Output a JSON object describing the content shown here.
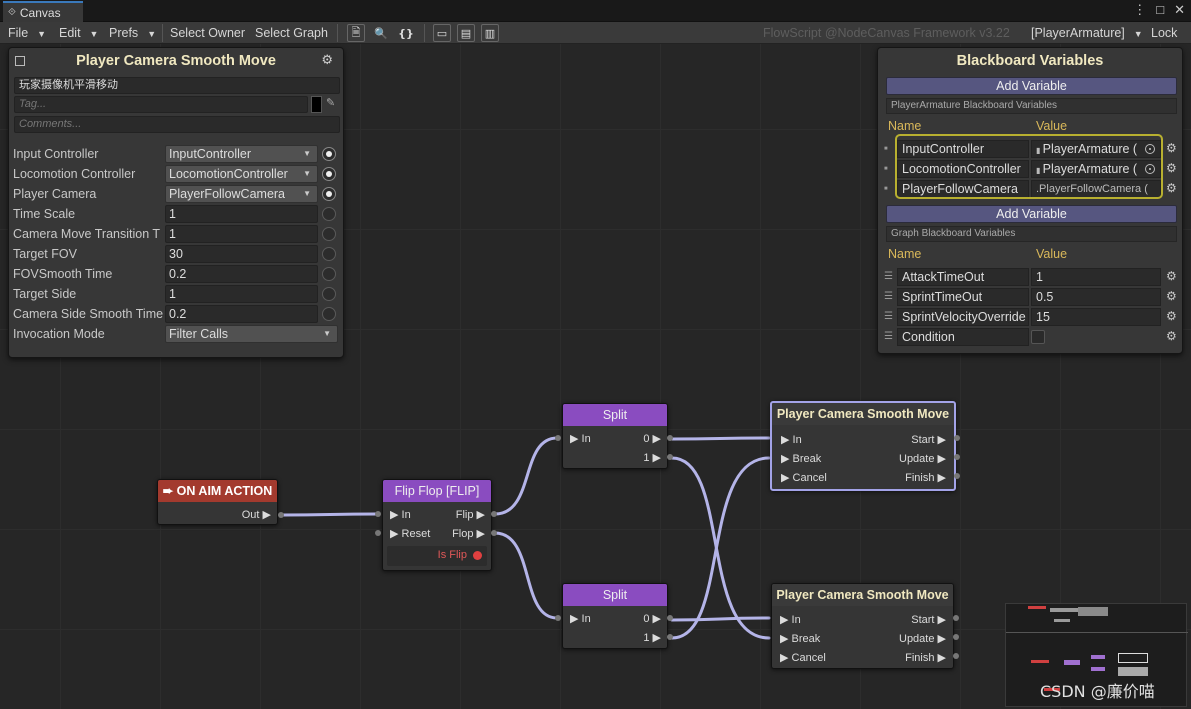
{
  "window": {
    "tab_title": "Canvas",
    "controls": [
      "⋮",
      "□",
      "✕"
    ]
  },
  "toolbar": {
    "file": "File",
    "edit": "Edit",
    "prefs": "Prefs",
    "select_owner": "Select Owner",
    "select_graph": "Select Graph",
    "framework_label": "FlowScript @NodeCanvas Framework v3.22",
    "owner_selector": "[PlayerArmature]",
    "lock": "Lock"
  },
  "inspector": {
    "title": "Player Camera Smooth Move",
    "name_field": "玩家摄像机平滑移动",
    "tag_placeholder": "Tag...",
    "comments_placeholder": "Comments...",
    "params": [
      {
        "label": "Input Controller",
        "value": "InputController",
        "kind": "drop",
        "dot": "on"
      },
      {
        "label": "Locomotion Controller",
        "value": "LocomotionController",
        "kind": "drop",
        "dot": "on"
      },
      {
        "label": "Player Camera",
        "value": "PlayerFollowCamera",
        "kind": "drop",
        "dot": "on"
      },
      {
        "label": "Time Scale",
        "value": "1",
        "kind": "text",
        "dot": "off"
      },
      {
        "label": "Camera Move Transition T",
        "value": "1",
        "kind": "text",
        "dot": "off"
      },
      {
        "label": "Target FOV",
        "value": "30",
        "kind": "text",
        "dot": "off"
      },
      {
        "label": "FOVSmooth Time",
        "value": "0.2",
        "kind": "text",
        "dot": "off"
      },
      {
        "label": "Target Side",
        "value": "1",
        "kind": "text",
        "dot": "off"
      },
      {
        "label": "Camera Side Smooth Time",
        "value": "0.2",
        "kind": "text",
        "dot": "off"
      },
      {
        "label": "Invocation Mode",
        "value": "Filter Calls",
        "kind": "dropwide",
        "dot": "none"
      }
    ]
  },
  "blackboard": {
    "title": "Blackboard Variables",
    "add_variable": "Add Variable",
    "section1_label": "PlayerArmature Blackboard Variables",
    "name_header": "Name",
    "value_header": "Value",
    "bb_vars": [
      {
        "name": "InputController",
        "value": "PlayerArmature (",
        "picker": true
      },
      {
        "name": "LocomotionController",
        "value": "PlayerArmature (",
        "picker": true
      },
      {
        "name": "PlayerFollowCamera",
        "value": ".PlayerFollowCamera (",
        "picker": false
      }
    ],
    "add_variable2": "Add Variable",
    "section2_label": "Graph Blackboard Variables",
    "graph_vars": [
      {
        "name": "AttackTimeOut",
        "value": "1"
      },
      {
        "name": "SprintTimeOut",
        "value": "0.5"
      },
      {
        "name": "SprintVelocityOverride",
        "value": "15"
      },
      {
        "name": "Condition",
        "value": ""
      }
    ]
  },
  "nodes": {
    "on_aim": {
      "title": "ON AIM ACTION",
      "out": "Out"
    },
    "flipflop": {
      "title": "Flip Flop [FLIP]",
      "in": "In",
      "reset": "Reset",
      "flip": "Flip",
      "flop": "Flop",
      "isflip": "Is Flip"
    },
    "split1": {
      "title": "Split",
      "in": "In",
      "o0": "0",
      "o1": "1"
    },
    "split2": {
      "title": "Split",
      "in": "In",
      "o0": "0",
      "o1": "1"
    },
    "camera1": {
      "title": "Player Camera Smooth Move",
      "in": "In",
      "brk": "Break",
      "cancel": "Cancel",
      "start": "Start",
      "update": "Update",
      "finish": "Finish"
    },
    "camera2": {
      "title": "Player Camera Smooth Move",
      "in": "In",
      "brk": "Break",
      "cancel": "Cancel",
      "start": "Start",
      "update": "Update",
      "finish": "Finish"
    }
  },
  "watermark": "CSDN @廉价喵",
  "colors": {
    "wire": "#b4b4e8",
    "selection": "#b8b030",
    "event_node": "#a33a2e",
    "flow_node": "#8a4cc0"
  }
}
